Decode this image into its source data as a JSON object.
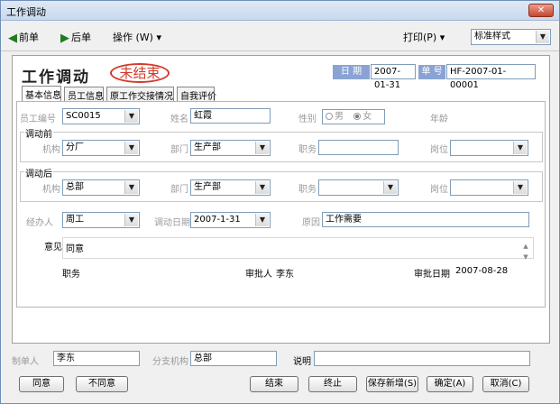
{
  "window": {
    "title": "工作调动",
    "close_glyph": "✕"
  },
  "toolbar": {
    "prev_label": "前单",
    "next_label": "后单",
    "ops_label": "操作 (W) ▾",
    "print_label": "打印(P) ▾",
    "style_value": "标准样式"
  },
  "header": {
    "title": "工作调动",
    "status": "未结束",
    "date_label": "日 期",
    "date_value": "2007-01-31",
    "number_label": "单 号",
    "number_value": "HF-2007-01-00001"
  },
  "tabs": [
    "基本信息",
    "员工信息",
    "原工作交接情况",
    "自我评价"
  ],
  "form": {
    "emp_id_label": "员工编号",
    "emp_id_value": "SC0015",
    "name_label": "姓名",
    "name_value": "虹霞",
    "gender_label": "性别",
    "gender_male": "男",
    "gender_female": "女",
    "age_label": "年龄",
    "before_title": "调动前",
    "before_org_label": "机构",
    "before_org_value": "分厂",
    "before_dept_label": "部门",
    "before_dept_value": "生产部",
    "before_job_label": "职务",
    "before_job_value": "",
    "before_post_label": "岗位",
    "before_post_value": "",
    "after_title": "调动后",
    "after_org_label": "机构",
    "after_org_value": "总部",
    "after_dept_label": "部门",
    "after_dept_value": "生产部",
    "after_job_label": "职务",
    "after_job_value": "",
    "after_post_label": "岗位",
    "after_post_value": "",
    "handler_label": "经办人",
    "handler_value": "周工",
    "transfer_date_label": "调动日期",
    "transfer_date_value": "2007-1-31",
    "reason_label": "原因",
    "reason_value": "工作需要",
    "opinion_label": "意见",
    "opinion_value": "同意",
    "duty_label": "职务",
    "approver_label": "审批人",
    "approver_value": "李东",
    "approve_date_label": "审批日期",
    "approve_date_value": "2007-08-28"
  },
  "footer": {
    "creator_label": "制单人",
    "creator_value": "李东",
    "branch_label": "分支机构",
    "branch_value": "总部",
    "note_label": "说明",
    "note_value": "",
    "buttons": {
      "agree": "同意",
      "disagree": "不同意",
      "finish": "结束",
      "terminate": "终止",
      "save_new": "保存新增(S)",
      "ok": "确定(A)",
      "cancel": "取消(C)"
    }
  }
}
